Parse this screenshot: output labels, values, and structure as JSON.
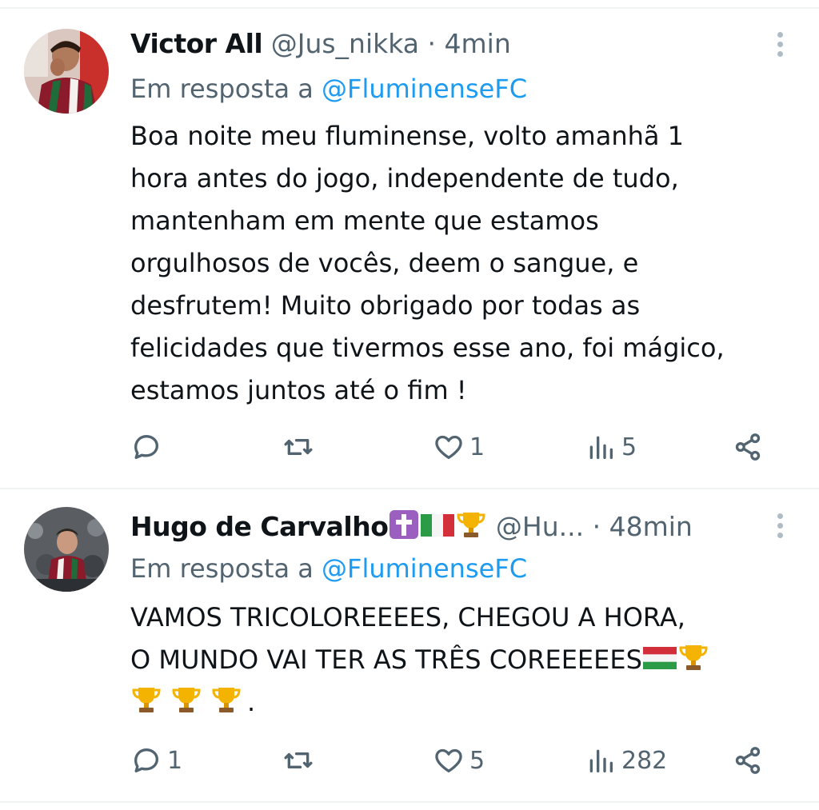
{
  "tweets": [
    {
      "name": "Victor All",
      "name_emojis": [],
      "handle": "@Jus_nikka",
      "separator": "·",
      "time": "4min",
      "reply_prefix": "Em resposta a",
      "reply_to": "@FluminenseFC",
      "body_lines": [
        "Boa noite meu fluminense, volto amanhã 1",
        "hora antes do jogo, independente de tudo,",
        "mantenham em mente que estamos",
        "orgulhosos de vocês, deem o sangue, e",
        "desfrutem! Muito obrigado por todas as",
        "felicidades que tivermos esse ano, foi mágico,",
        "estamos juntos até o fim !"
      ],
      "counts": {
        "replies": "",
        "retweets": "",
        "likes": "1",
        "views": "5"
      }
    },
    {
      "name": "Hugo de Carvalho",
      "name_emojis": [
        "latin-cross-emoji",
        "italy-flag-emoji",
        "trophy-emoji"
      ],
      "handle": "@Hu...",
      "separator": "·",
      "time": "48min",
      "reply_prefix": "Em resposta a",
      "reply_to": "@FluminenseFC",
      "body_lines": [
        "VAMOS TRICOLOREEEES, CHEGOU A HORA,",
        "O MUNDO VAI TER AS TRÊS COREEEEES",
        "."
      ],
      "body_emojis": [
        "hungary-flag-emoji",
        "trophy-emoji",
        "trophy-emoji",
        "trophy-emoji",
        "trophy-emoji"
      ],
      "counts": {
        "replies": "1",
        "retweets": "",
        "likes": "5",
        "views": "282"
      }
    }
  ],
  "icons": {
    "reply": "reply-icon",
    "retweet": "retweet-icon",
    "like": "heart-icon",
    "views": "views-icon",
    "share": "share-icon",
    "more": "more-vertical-icon"
  },
  "colors": {
    "text": "#0f1419",
    "secondary": "#536471",
    "link": "#1d9bf0",
    "divider": "#eff3f4"
  }
}
